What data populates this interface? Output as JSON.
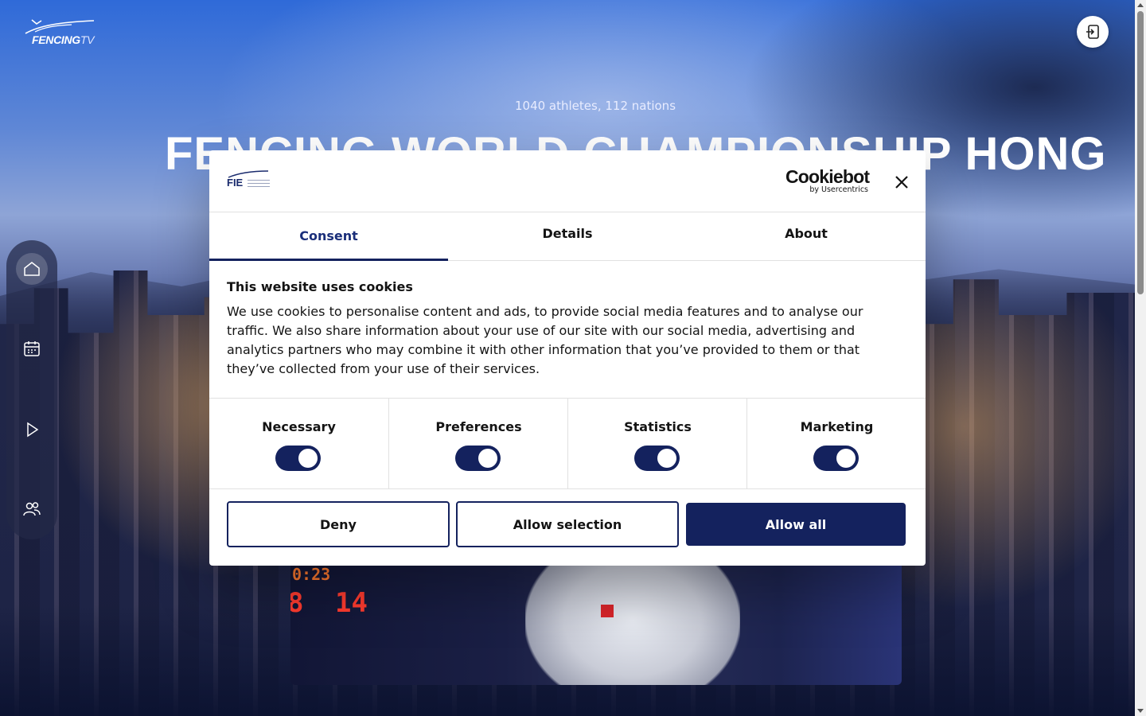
{
  "site": {
    "logo_word": "FENCING",
    "logo_suffix": "TV"
  },
  "hero": {
    "subtitle": "1040 athletes, 112 nations",
    "title": "FENCING WORLD CHAMPIONSHIP HONG"
  },
  "sidebar": {
    "items": [
      {
        "icon": "home-icon",
        "active": true
      },
      {
        "icon": "calendar-icon",
        "active": false
      },
      {
        "icon": "play-icon",
        "active": false
      },
      {
        "icon": "users-icon",
        "active": false
      }
    ]
  },
  "video": {
    "clock": "0:23",
    "score_left": "8",
    "score_right": "14"
  },
  "cookie_dialog": {
    "brand_logo": "FIE",
    "provider": "Cookiebot",
    "provider_by": "by Usercentrics",
    "tabs": [
      "Consent",
      "Details",
      "About"
    ],
    "active_tab": "Consent",
    "heading": "This website uses cookies",
    "body": "We use cookies to personalise content and ads, to provide social media features and to analyse our traffic. We also share information about your use of our site with our social media, advertising and analytics partners who may combine it with other information that you’ve provided to them or that they’ve collected from your use of their services.",
    "categories": [
      {
        "label": "Necessary",
        "enabled": true
      },
      {
        "label": "Preferences",
        "enabled": true
      },
      {
        "label": "Statistics",
        "enabled": true
      },
      {
        "label": "Marketing",
        "enabled": true
      }
    ],
    "buttons": {
      "deny": "Deny",
      "allow_selection": "Allow selection",
      "allow_all": "Allow all"
    }
  },
  "colors": {
    "primary_navy": "#14225e",
    "background": "#0b1230"
  }
}
